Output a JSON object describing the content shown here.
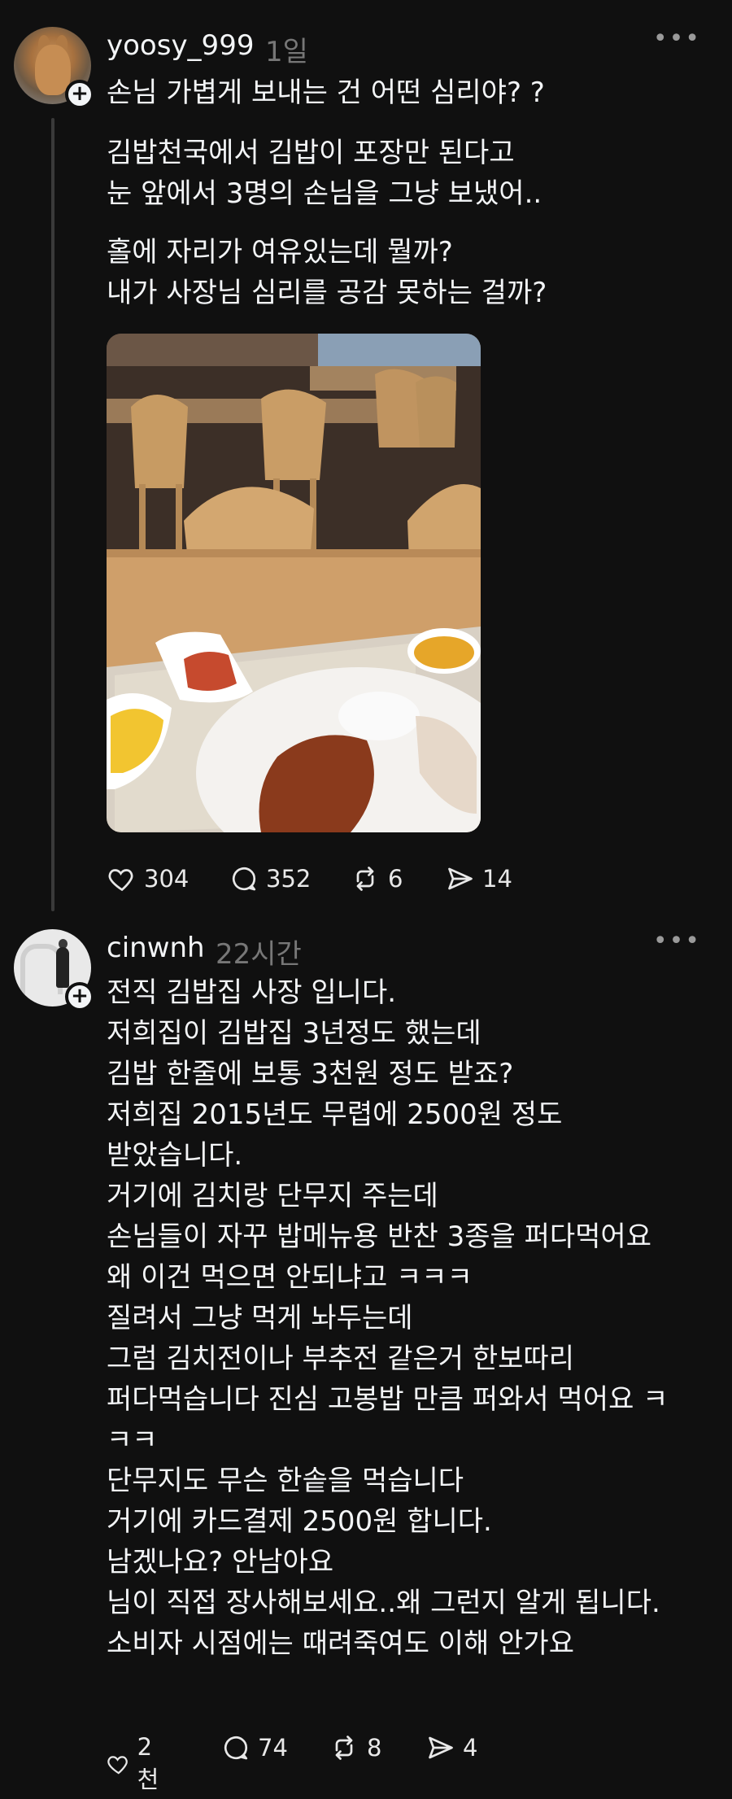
{
  "posts": [
    {
      "username": "yoosy_999",
      "time": "1일",
      "more_icon": "more-dots-icon",
      "title": "손님 가볍게 보내는 건 어떤 심리야? ?",
      "paragraph1": [
        "김밥천국에서 김밥이 포장만 된다고",
        "눈 앞에서 3명의 손님을 그냥 보냈어.."
      ],
      "paragraph2": [
        "홀에 자리가 여유있는데 뭘까?",
        "내가 사장님 심리를 공감 못하는 걸까?"
      ],
      "image": "restaurant-table-photo",
      "likes": "304",
      "comments": "352",
      "reposts": "6",
      "shares": "14"
    },
    {
      "username": "cinwnh",
      "time": "22시간",
      "more_icon": "more-dots-icon",
      "lines": [
        "전직 김밥집 사장 입니다.",
        "저희집이 김밥집 3년정도 했는데",
        "김밥 한줄에 보통 3천원 정도 받죠?",
        "저희집 2015년도 무렵에 2500원 정도",
        "받았습니다.",
        "거기에 김치랑 단무지 주는데",
        "손님들이 자꾸 밥메뉴용 반찬 3종을 퍼다먹어요",
        "왜 이건 먹으면 안되냐고 ㅋㅋㅋ",
        "질려서 그냥 먹게 놔두는데",
        "그럼 김치전이나 부추전 같은거 한보따리",
        "퍼다먹습니다 진심 고봉밥 만큼 퍼와서 먹어요 ㅋ",
        "ㅋㅋ",
        "단무지도 무슨 한솥을 먹습니다",
        "거기에 카드결제 2500원 합니다.",
        "남겠나요?  안남아요",
        "님이 직접 장사해보세요..왜 그런지 알게 됩니다.",
        "소비자 시점에는 때려죽여도 이해 안가요"
      ],
      "likes": "2천",
      "comments": "74",
      "reposts": "8",
      "shares": "4"
    }
  ],
  "colors": {
    "background": "#101010",
    "text": "#f3f5f7",
    "secondary": "#777777",
    "thread_line": "#3a3a3a"
  }
}
